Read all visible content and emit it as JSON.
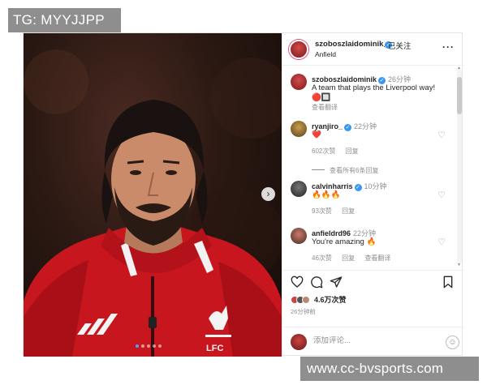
{
  "watermarks": {
    "top": "TG: MYYJJPP",
    "bottom": "www.cc-bvsports.com"
  },
  "post": {
    "author": "szoboszlaidominik",
    "follow_status": "已关注",
    "location": "Anfield",
    "more_label": "···",
    "image_dots": 5,
    "active_dot": 0,
    "next_label": "›"
  },
  "caption": {
    "user": "szoboszlaidominik",
    "time": "26分钟",
    "text": "A team that plays the Liverpool way! 🔴🔲",
    "translate": "查看翻译"
  },
  "comments": [
    {
      "user": "ryanjiro_",
      "time": "22分钟",
      "text": "❤️",
      "likes": "602次赞",
      "reply": "回复",
      "translate": ""
    },
    {
      "user": "calvinharris",
      "time": "10分钟",
      "text": "🔥🔥🔥",
      "likes": "93次赞",
      "reply": "回复",
      "translate": ""
    },
    {
      "user": "anfieldrd96",
      "time": "22分钟",
      "text": "You're amazing 🔥",
      "likes": "46次赞",
      "reply": "回复",
      "translate": "查看翻译"
    }
  ],
  "view_replies": "查看所有6条回复",
  "actions": {
    "like_icon": "heart-icon",
    "comment_icon": "comment-icon",
    "share_icon": "send-icon",
    "save_icon": "bookmark-icon"
  },
  "likes_count": "4.6万次赞",
  "posted_ago": "26分钟前",
  "add_comment_placeholder": "添加评论...",
  "colors": {
    "verified": "#3897f0",
    "liverpool_red": "#c8102e",
    "muted_text": "#8e8e8e"
  }
}
